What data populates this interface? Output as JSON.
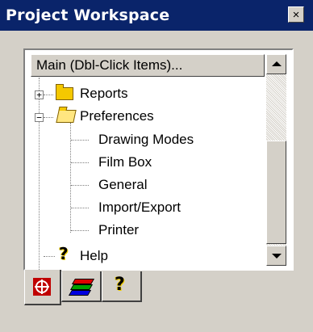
{
  "window": {
    "title": "Project Workspace",
    "close_label": "×"
  },
  "tree": {
    "header": "Main (Dbl-Click Items)...",
    "items": [
      {
        "label": "Reports",
        "icon": "folder-closed-icon",
        "expander": "+"
      },
      {
        "label": "Preferences",
        "icon": "folder-open-icon",
        "expander": "−"
      },
      {
        "label": "Drawing Modes"
      },
      {
        "label": "Film Box"
      },
      {
        "label": "General"
      },
      {
        "label": "Import/Export"
      },
      {
        "label": "Printer"
      },
      {
        "label": "Help",
        "icon": "help-icon"
      }
    ]
  },
  "tabs": [
    {
      "icon": "target-icon",
      "active": true
    },
    {
      "icon": "layers-icon",
      "active": false
    },
    {
      "icon": "help-icon",
      "active": false
    }
  ],
  "icons": {
    "help_glyph": "?"
  },
  "colors": {
    "titlebar": "#0a246a",
    "face": "#d4d0c8",
    "folder": "#f4c800",
    "target_red": "#c00000",
    "layer_red": "#e00000",
    "layer_green": "#00a000",
    "layer_blue": "#0000e0"
  }
}
